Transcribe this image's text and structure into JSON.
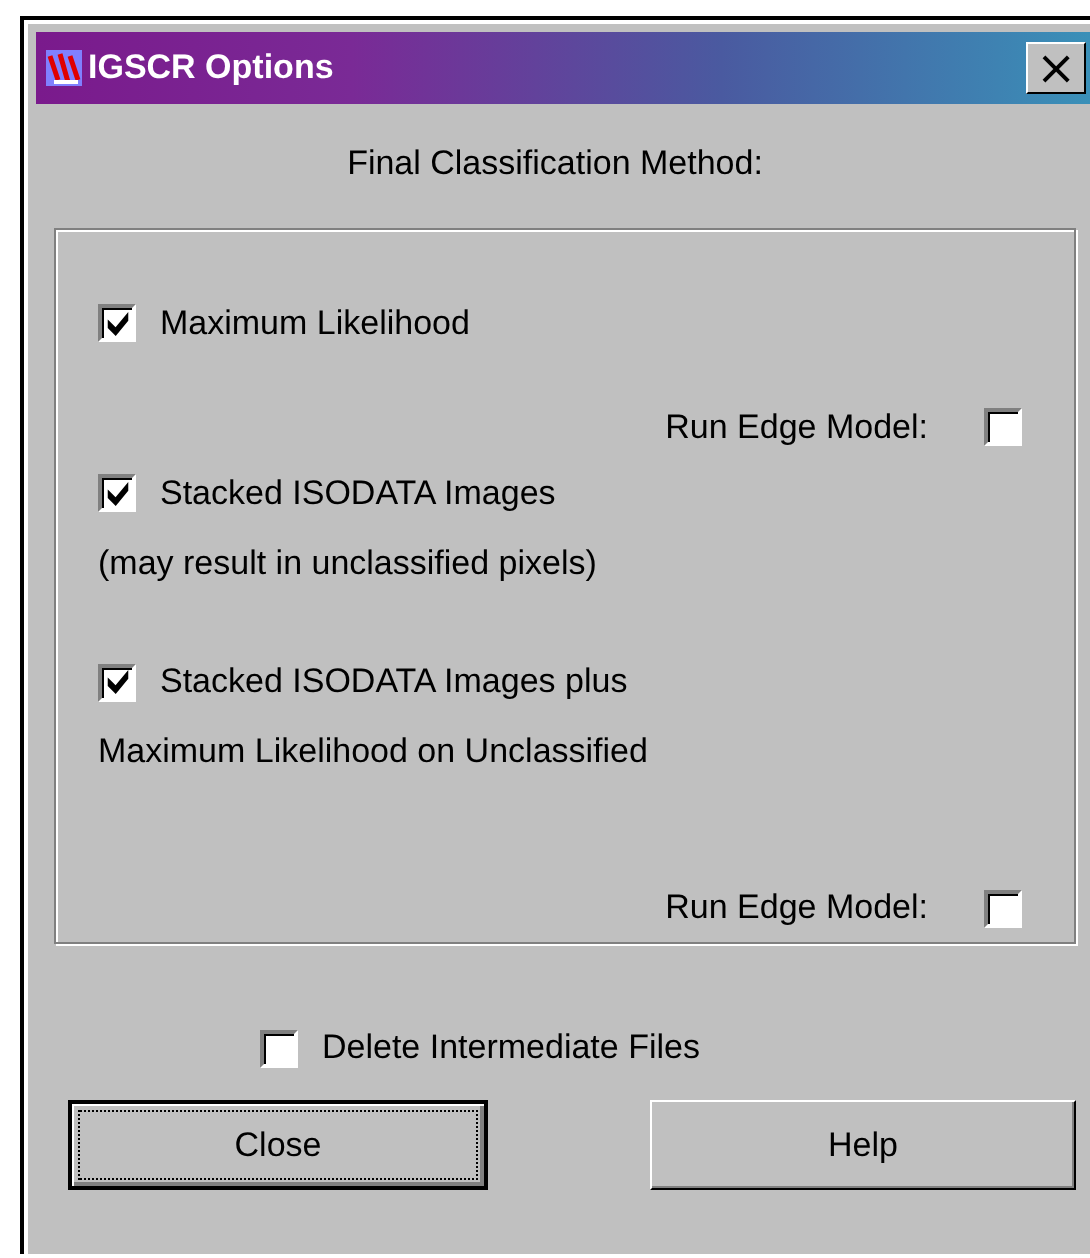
{
  "window": {
    "title": "IGSCR Options",
    "close": "×"
  },
  "heading": "Final Classification Method:",
  "group_items": [
    {
      "kind": "option",
      "label": "Maximum Likelihood",
      "checked": true
    },
    {
      "kind": "sub_option",
      "label": "Run Edge Model:",
      "checked": false
    },
    {
      "kind": "option",
      "label": "Stacked ISODATA Images",
      "checked": true
    },
    {
      "kind": "note",
      "label": "(may result in unclassified pixels)"
    },
    {
      "kind": "option",
      "label": "Stacked ISODATA Images plus",
      "checked": true
    },
    {
      "kind": "note",
      "label": "Maximum Likelihood on Unclassified"
    },
    {
      "kind": "sub_option",
      "label": "Run Edge Model:",
      "checked": false
    }
  ],
  "delete_option": {
    "label": "Delete Intermediate Files",
    "checked": false
  },
  "buttons": [
    {
      "label": "Close",
      "default": true
    },
    {
      "label": "Help",
      "default": false
    }
  ]
}
